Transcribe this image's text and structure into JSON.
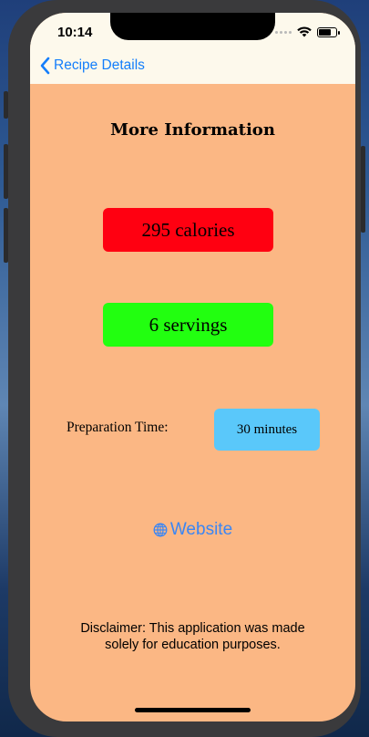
{
  "status_bar": {
    "time": "10:14"
  },
  "nav": {
    "back_label": "Recipe Details"
  },
  "content": {
    "heading": "More Information",
    "calories": "295 calories",
    "servings": "6 servings",
    "prep_label": "Preparation Time:",
    "prep_value": "30 minutes",
    "website_label": "Website",
    "disclaimer": "Disclaimer: This application was made solely for education purposes."
  },
  "colors": {
    "background": "#fbb784",
    "nav_bar": "#fdf9ec",
    "calories_box": "#ff0011",
    "servings_box": "#22ff10",
    "prep_box": "#5ac8fa",
    "link": "#147efb"
  }
}
